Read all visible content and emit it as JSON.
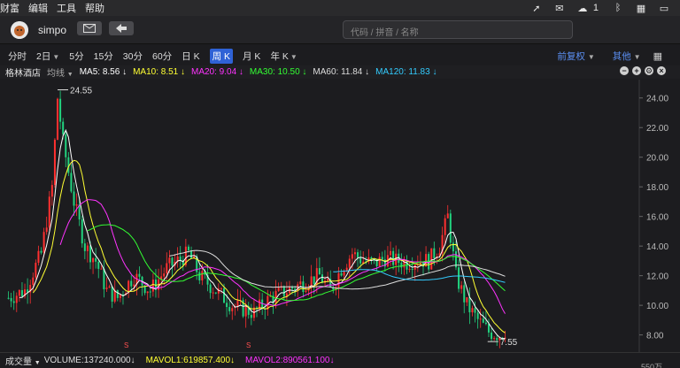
{
  "menubar": {
    "items": [
      "财富",
      "编辑",
      "工具",
      "帮助"
    ],
    "notification_count": "1"
  },
  "toolbar": {
    "username": "simpo",
    "search_placeholder": "代码 / 拼音 / 名称"
  },
  "periods": [
    {
      "label": "分时",
      "active": false
    },
    {
      "label": "2日",
      "active": false,
      "dropdown": true
    },
    {
      "label": "5分",
      "active": false
    },
    {
      "label": "15分",
      "active": false
    },
    {
      "label": "30分",
      "active": false
    },
    {
      "label": "60分",
      "active": false
    },
    {
      "label": "日 K",
      "active": false
    },
    {
      "label": "周 K",
      "active": true
    },
    {
      "label": "月 K",
      "active": false
    },
    {
      "label": "年 K",
      "active": false,
      "dropdown": true
    }
  ],
  "adjust": {
    "label": "前复权",
    "other_label": "其他"
  },
  "stock": {
    "name": "格林酒店",
    "indicator": "均线",
    "ma": [
      {
        "label": "MA5: 8.56 ↓",
        "color": "#ffffff"
      },
      {
        "label": "MA10: 8.51 ↓",
        "color": "#ffff33"
      },
      {
        "label": "MA20: 9.04 ↓",
        "color": "#ff33ff"
      },
      {
        "label": "MA30: 10.50 ↓",
        "color": "#33ff33"
      },
      {
        "label": "MA60: 11.84 ↓",
        "color": "#dddddd"
      },
      {
        "label": "MA120: 11.83 ↓",
        "color": "#33ccff"
      }
    ]
  },
  "chart_data": {
    "type": "candlestick",
    "y_ticks": [
      "24.00",
      "22.00",
      "20.00",
      "18.00",
      "16.00",
      "14.00",
      "12.00",
      "10.00",
      "8.00"
    ],
    "ylim": [
      7.2,
      25.0
    ],
    "high_label": "24.55",
    "low_label": "7.55",
    "volume_tick": "550万",
    "split_markers": [
      "S",
      "S"
    ],
    "colors": {
      "up": "#ff3030",
      "down": "#22d37f"
    }
  },
  "volume": {
    "label": "成交量",
    "value": "VOLUME:137240.000↓",
    "mavol1": "MAVOL1:619857.400↓",
    "mavol2": "MAVOL2:890561.100↓",
    "mavol1_color": "#ffff33",
    "mavol2_color": "#ff33ff"
  }
}
